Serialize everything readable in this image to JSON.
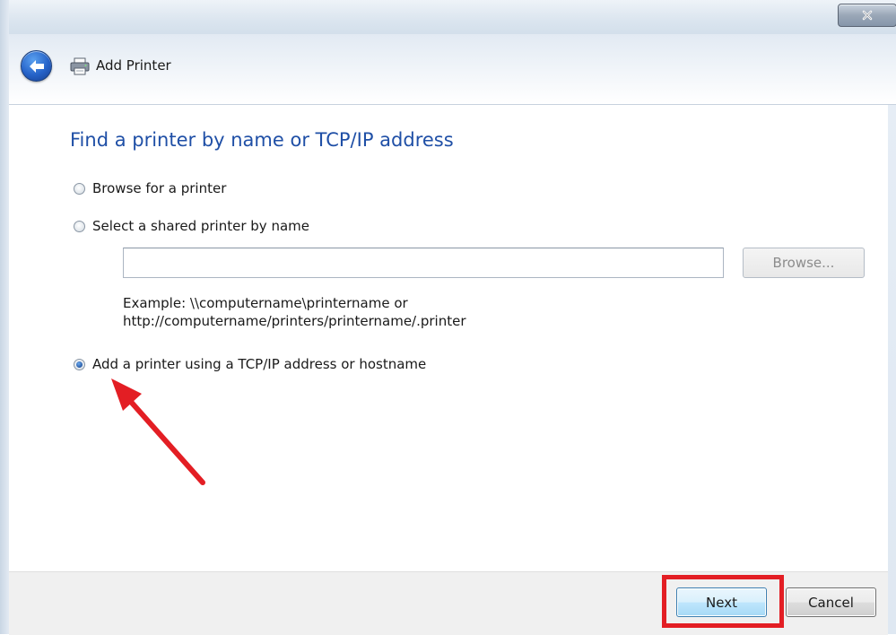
{
  "window": {
    "title": "Add Printer"
  },
  "heading": "Find a printer by name or TCP/IP address",
  "options": [
    {
      "label": "Browse for a printer",
      "checked": false
    },
    {
      "label": "Select a shared printer by name",
      "checked": false
    },
    {
      "label": "Add a printer using a TCP/IP address or hostname",
      "checked": true
    }
  ],
  "shared_printer": {
    "value": "",
    "browse_label": "Browse...",
    "example_line1": "Example: \\\\computername\\printername or",
    "example_line2": "http://computername/printers/printername/.printer"
  },
  "footer": {
    "next_label": "Next",
    "cancel_label": "Cancel"
  },
  "icons": {
    "back": "back-arrow-icon",
    "printer": "printer-icon",
    "close": "close-icon"
  },
  "colors": {
    "heading": "#1f4fa6",
    "annotation": "#e31e24"
  }
}
